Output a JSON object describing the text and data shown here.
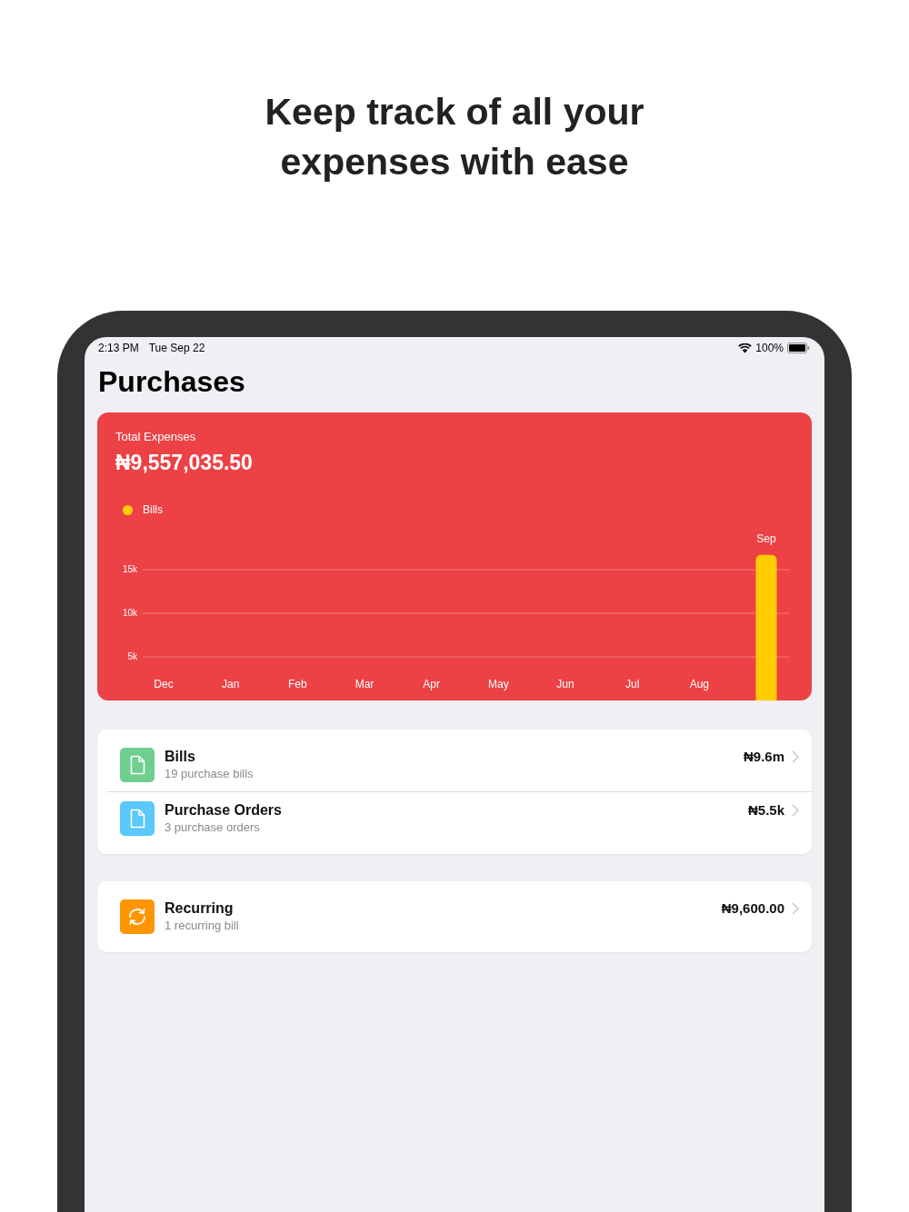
{
  "headline": "Keep track of all your expenses with ease",
  "status_bar": {
    "time": "2:13 PM",
    "date": "Tue Sep 22",
    "battery": "100%"
  },
  "title": "Purchases",
  "summary": {
    "label": "Total Expenses",
    "amount": "₦9,557,035.50",
    "chart_data": {
      "type": "bar",
      "categories": [
        "Dec",
        "Jan",
        "Feb",
        "Mar",
        "Apr",
        "May",
        "Jun",
        "Jul",
        "Aug",
        "Sep"
      ],
      "series": [
        {
          "name": "Bills",
          "color": "#ffcc00",
          "values": [
            0,
            0,
            0,
            0,
            0,
            0,
            0,
            0,
            0,
            16700
          ]
        }
      ],
      "grid": true,
      "ylim": [
        0,
        16700
      ],
      "yticks": [
        {
          "value": 5000,
          "label": "5k"
        },
        {
          "value": 10000,
          "label": "10k"
        },
        {
          "value": 15000,
          "label": "15k"
        }
      ]
    }
  },
  "lists": [
    {
      "rows": [
        {
          "kind": "document",
          "title": "Bills",
          "subtitle": "19 purchase bills",
          "amount": "₦9.6m",
          "color": "#6fcf8f"
        },
        {
          "kind": "document",
          "title": "Purchase Orders",
          "subtitle": "3 purchase orders",
          "amount": "₦5.5k",
          "color": "#5ac8fa"
        }
      ]
    },
    {
      "rows": [
        {
          "kind": "recurring",
          "title": "Recurring",
          "subtitle": "1 recurring bill",
          "amount": "₦9,600.00",
          "color": "#ff9500"
        }
      ]
    }
  ]
}
